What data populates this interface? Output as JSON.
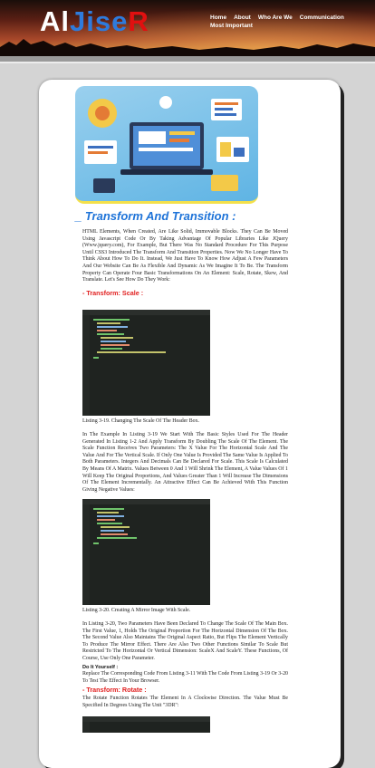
{
  "header": {
    "logo": {
      "part1": "Al",
      "part2": "Jise",
      "part3": "R"
    },
    "nav": [
      "Home",
      "About",
      "Who Are We",
      "Communication",
      "Most Important"
    ]
  },
  "article": {
    "title": "_ Transform And Transition :",
    "intro": "HTML Elements, When Created, Are Like Solid, Immovable Blocks. They Can Be Moved Using Javascript Code Or By Taking Advantage Of Popular Libraries Like JQuery (Www.jquery.com), For Example, But There Was No Standard Procedure For This Purpose Until CSS3 Introduced The Transform And Transition Properties. Now We No Longer Have To Think About How To Do It. Instead, We Just Have To Know How Adjust A Few Parameters And Our Website Can Be As Flexible And Dynamic As We Imagine It To Be. The Transform Property Can Operate Four Basic Transformations On An Element: Scale, Rotate, Skew, And Translate. Let's See How Do They Work:",
    "scale_heading": "- Transform: Scale :",
    "caption1": "Listing 3-19. Changing The Scale Of The Header Box.",
    "para2": "In The Example In Listing 3-19 We Start With The Basic Styles Used For The Header Generated In Listing 1-2 And Apply Transform By Doubling The Scale Of The Element. The Scale Function Receives Two Parameters: The X Value For The Horizontal Scale And The Value And For The Vertical Scale. If Only One Value Is Provided The Same Value Is Applied To Both Parameters. Integers And Decimals Can Be Declared For Scale. This Scale Is Calculated By Means Of A Matrix. Values Between 0 And 1 Will Shrink The Element, A Value Values Of 1 Will Keep The Original Proportions, And Values Greater Than 1 Will Increase The Dimensions Of The Element Incrementally. An Attractive Effect Can Be Achieved With This Function Giving Negative Values:",
    "caption2": "Listing 3-20. Creating A Mirror Image With Scale.",
    "para3": "In Listing 3-20, Two Parameters Have Been Declared To Change The Scale Of The Main Box. The First Value, 1, Holds The Original Proportion For The Horizontal Dimension Of The Box. The Second Value Also Maintains The Original Aspect Ratio, But Flips The Element Vertically To Produce The Mirror Effect. There Are Also Two Other Functions Similar To Scale But Restricted To The Horizontal Or Vertical Dimension: ScaleX And ScaleY. These Functions, Of Course, Use Only One Parameter.",
    "do_it": "Do It Yourself :",
    "do_it_text": "Replace The Corresponding Code From Listing 3-11 With The Code From Listing 3-19 Or 3-20 To Test The Effect In Your Browser.",
    "rotate_heading": "- Transform: Rotate :",
    "rotate_text": "The Rotate Function Rotates The Element In A Clockwise Direction. The Value Must Be Specified In Degrees Using The Unit \"3DR\":"
  },
  "colors": {
    "title": "#1e73d8",
    "subheading": "#e12020",
    "logo_blue": "#2e7bdc",
    "logo_red": "#e01010"
  }
}
